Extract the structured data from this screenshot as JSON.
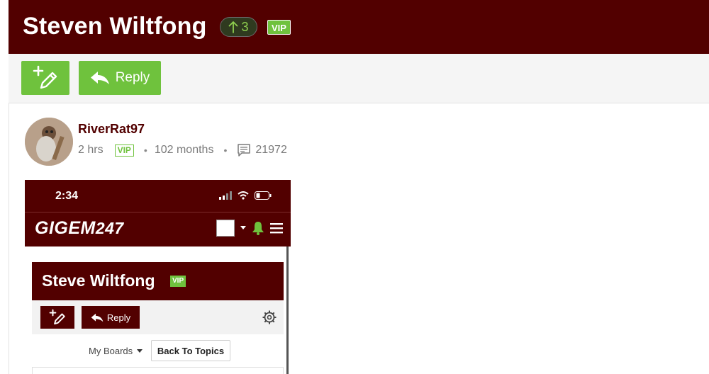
{
  "header": {
    "title": "Steven Wiltfong",
    "vote_count": "3",
    "vip_badge": "VIP"
  },
  "toolbar": {
    "new_post_icon": "pencil-plus-icon",
    "reply_label": "Reply",
    "reply_icon": "reply-arrow-icon"
  },
  "post": {
    "username": "RiverRat97",
    "time_ago": "2 hrs",
    "vip_badge": "VIP",
    "tenure": "102 months",
    "message_count": "21972",
    "messages_icon": "message-icon"
  },
  "embedded_screenshot": {
    "time": "2:34",
    "logo": "GIGEM",
    "logo_suffix": "247",
    "card_title": "Steve Wiltfong",
    "card_vip": "VIP",
    "reply_label": "Reply",
    "my_boards": "My Boards",
    "back_to_topics": "Back To Topics"
  },
  "colors": {
    "brand_maroon": "#520000",
    "accent_green": "#6fc23d"
  }
}
